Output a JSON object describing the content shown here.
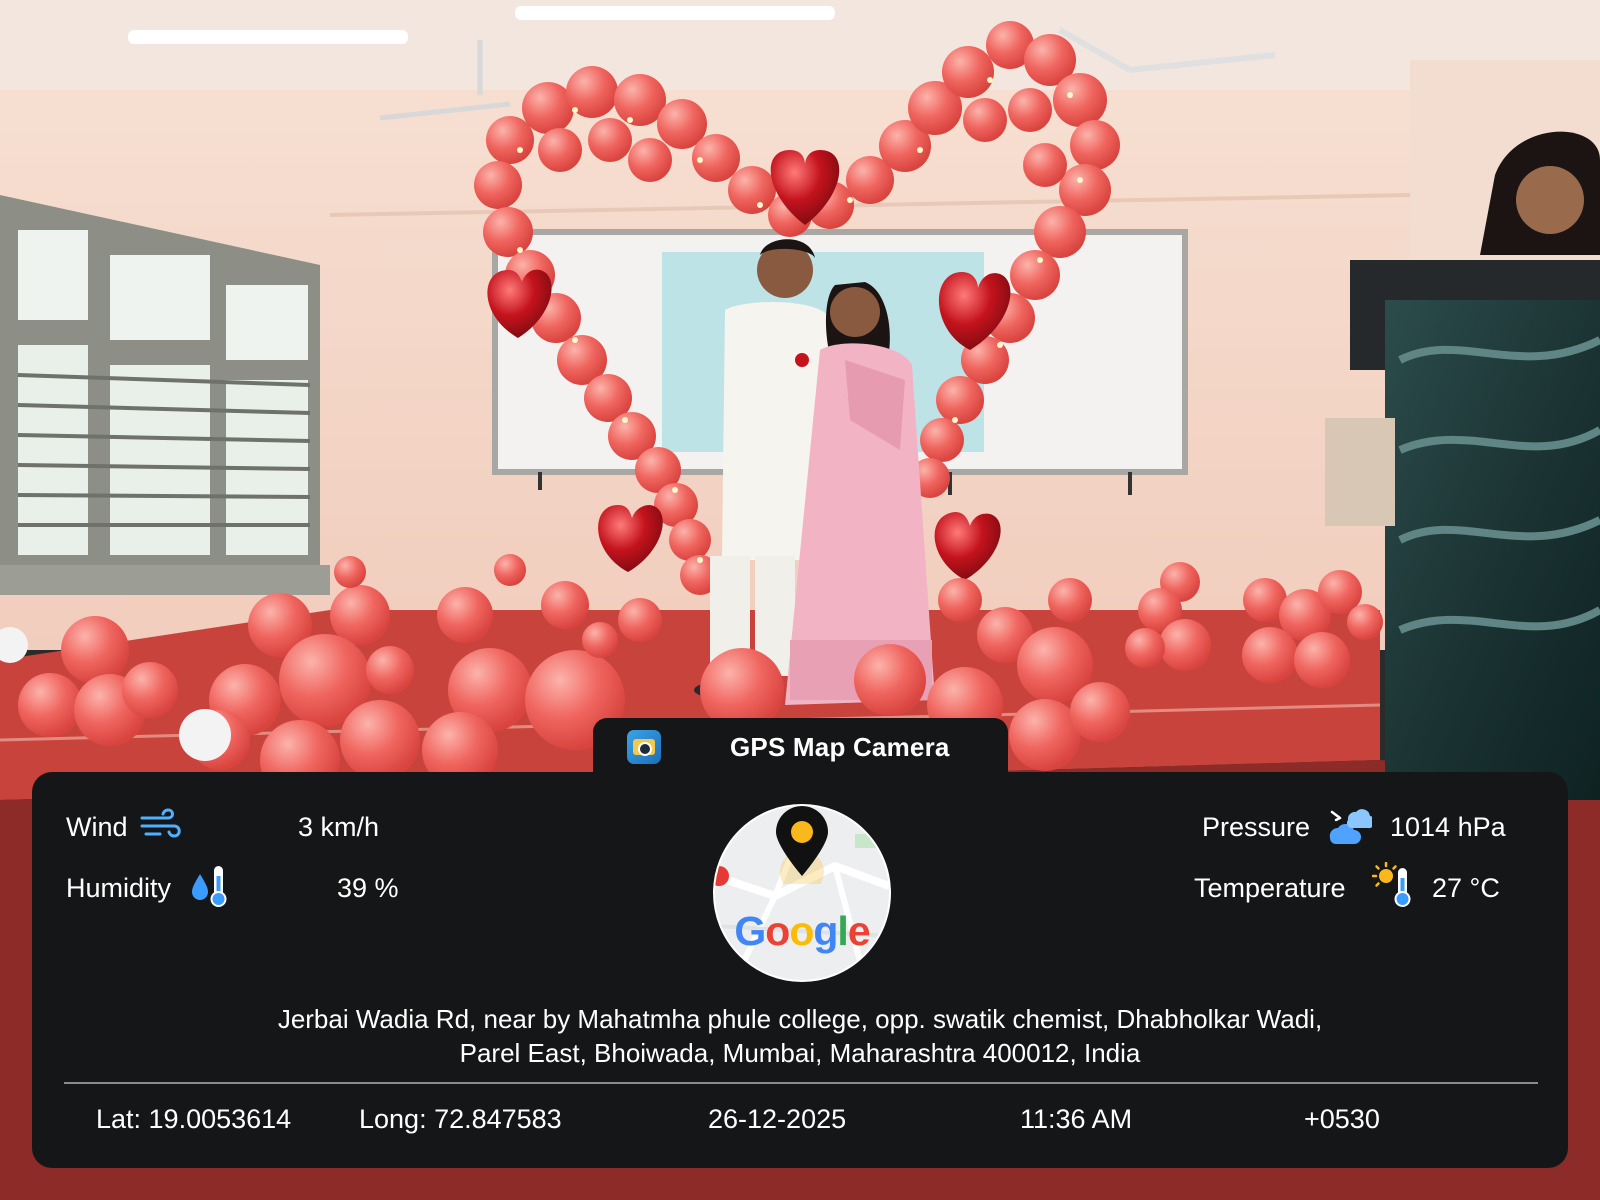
{
  "app": {
    "title": "GPS Map Camera",
    "logo_icon": "gps-map-camera-app-icon"
  },
  "weather": {
    "wind": {
      "label": "Wind",
      "value": "3 km/h",
      "icon": "wind-icon"
    },
    "humidity": {
      "label": "Humidity",
      "value": "39 %",
      "icon": "humidity-thermometer-icon"
    },
    "pressure": {
      "label": "Pressure",
      "value": "1014 hPa",
      "icon": "pressure-cloud-icon"
    },
    "temperature": {
      "label": "Temperature",
      "value": "27 °C",
      "icon": "sun-thermometer-icon"
    }
  },
  "map": {
    "brand": "Google",
    "pin_icon": "location-pin-icon"
  },
  "address": {
    "line1": "Jerbai Wadia Rd, near by Mahatmha phule college, opp. swatik chemist, Dhabholkar Wadi,",
    "line2": "Parel East, Bhoiwada, Mumbai, Maharashtra 400012, India"
  },
  "footer": {
    "lat": "Lat: 19.0053614",
    "long": "Long: 72.847583",
    "date": "26-12-2025",
    "time": "11:36 AM",
    "tz": "+0530"
  },
  "colors": {
    "panel_bg": "#151617",
    "balloon": "#f0655f",
    "balloon_light": "#f79a92",
    "foil_red": "#c4131d",
    "wall": "#f3d6c6",
    "stage": "#c8433c"
  }
}
